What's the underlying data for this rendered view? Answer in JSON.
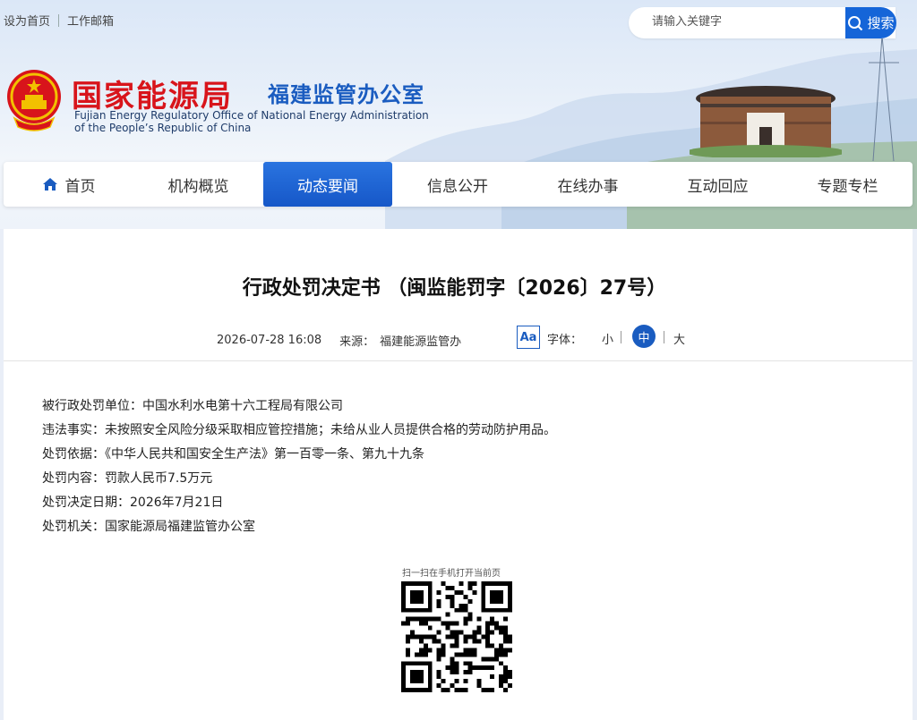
{
  "header": {
    "set_home": "设为首页",
    "work_mail": "工作邮箱",
    "search_placeholder": "请输入关键字",
    "search_button": "搜索",
    "title_cn": "国家能源局",
    "title_sub": "福建监管办公室",
    "title_en_line1": "Fujian Energy Regulatory Office of National Energy Administration",
    "title_en_line2": "of the People’s Republic of China"
  },
  "nav": {
    "items": [
      {
        "label": "首页",
        "icon": "home-icon"
      },
      {
        "label": "机构概览"
      },
      {
        "label": "动态要闻",
        "active": true
      },
      {
        "label": "信息公开"
      },
      {
        "label": "在线办事"
      },
      {
        "label": "互动回应"
      },
      {
        "label": "专题专栏"
      }
    ]
  },
  "article": {
    "title": "行政处罚决定书 （闽监能罚字〔2026〕27号）",
    "date": "2026-07-28 16:08",
    "source_label": "来源：",
    "source": "福建能源监管办",
    "font_icon": "Aa",
    "font_label": "字体：",
    "font_small": "小",
    "font_medium": "中",
    "font_large": "大",
    "lines": [
      "被行政处罚单位：中国水利水电第十六工程局有限公司",
      "违法事实：未按照安全风险分级采取相应管控措施；未给从业人员提供合格的劳动防护用品。",
      "处罚依据：《中华人民共和国安全生产法》第一百零一条、第九十九条",
      "处罚内容：罚款人民币7.5万元",
      "处罚决定日期：2026年7月21日",
      "处罚机关：国家能源局福建监管办公室"
    ],
    "qr_caption": "扫一扫在手机打开当前页"
  },
  "colors": {
    "accent": "#1565d8",
    "title_red": "#d8141b",
    "title_blue": "#1a5cc0"
  }
}
